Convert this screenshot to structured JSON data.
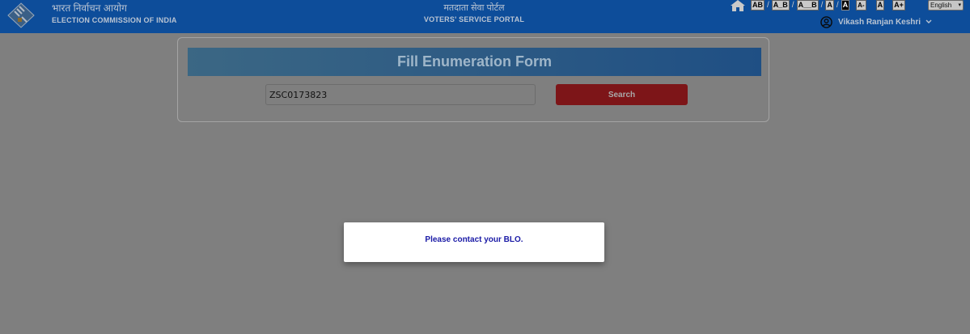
{
  "header": {
    "org_hindi": "भारत निर्वाचन आयोग",
    "org_english": "ELECTION COMMISSION OF INDIA",
    "portal_hindi": "मतदाता सेवा पोर्टल",
    "portal_english": "VOTERS' SERVICE PORTAL",
    "accessibility": {
      "spacing_1": "AB",
      "spacing_2": "A_B",
      "spacing_3": "A__B",
      "contrast_light": "A",
      "contrast_dark": "A",
      "font_decrease": "A-",
      "font_normal": "A",
      "font_increase": "A+"
    },
    "language": "English",
    "user_name": "Vikash Ranjan Keshri"
  },
  "form": {
    "title": "Fill Enumeration Form",
    "search_value": "ZSC0173823",
    "search_button": "Search"
  },
  "modal": {
    "message": "Please contact your BLO."
  },
  "colors": {
    "header_bg": "#0d4d9a",
    "overlay": "#7f7f7f",
    "search_button": "#7d1518",
    "modal_text": "#1a1aa6"
  }
}
